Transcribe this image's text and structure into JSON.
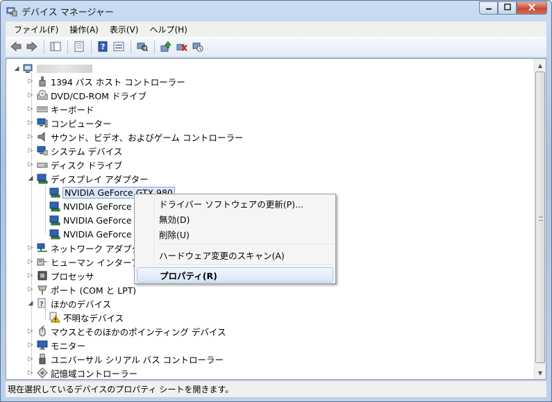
{
  "window": {
    "title": "デバイス マネージャー",
    "minimize_icon": "minimize-icon",
    "maximize_icon": "maximize-icon",
    "close_icon": "close-icon"
  },
  "menubar": {
    "items": [
      "ファイル(F)",
      "操作(A)",
      "表示(V)",
      "ヘルプ(H)"
    ]
  },
  "toolbar": {
    "icons": [
      "back-arrow-icon",
      "forward-arrow-icon",
      "show-hide-tree-icon",
      "properties-icon",
      "help-icon",
      "view-icon",
      "scan-hardware-icon",
      "update-driver-icon",
      "uninstall-icon",
      "disable-device-icon"
    ]
  },
  "tree": {
    "root_label": "",
    "categories": [
      {
        "label": "1394 バス ホスト コントローラー",
        "icon": "bus-controller-icon",
        "expanded": false
      },
      {
        "label": "DVD/CD-ROM ドライブ",
        "icon": "dvd-drive-icon",
        "expanded": false
      },
      {
        "label": "キーボード",
        "icon": "keyboard-icon",
        "expanded": false
      },
      {
        "label": "コンピューター",
        "icon": "computer-icon",
        "expanded": false
      },
      {
        "label": "サウンド、ビデオ、およびゲーム コントローラー",
        "icon": "speaker-icon",
        "expanded": false
      },
      {
        "label": "システム デバイス",
        "icon": "system-device-icon",
        "expanded": false
      },
      {
        "label": "ディスク ドライブ",
        "icon": "disk-drive-icon",
        "expanded": false
      },
      {
        "label": "ディスプレイ アダプター",
        "icon": "display-adapter-icon",
        "expanded": true
      },
      {
        "label": "ネットワーク アダプター",
        "icon": "network-adapter-icon",
        "expanded": false
      },
      {
        "label": "ヒューマン インターフェース デバイス",
        "icon": "hid-icon",
        "expanded": false
      },
      {
        "label": "プロセッサ",
        "icon": "processor-icon",
        "expanded": false
      },
      {
        "label": "ポート (COM と LPT)",
        "icon": "port-icon",
        "expanded": false
      },
      {
        "label": "ほかのデバイス",
        "icon": "other-devices-icon",
        "expanded": true
      },
      {
        "label": "マウスとそのほかのポインティング デバイス",
        "icon": "mouse-icon",
        "expanded": false
      },
      {
        "label": "モニター",
        "icon": "monitor-icon",
        "expanded": false
      },
      {
        "label": "ユニバーサル シリアル バス コントローラー",
        "icon": "usb-icon",
        "expanded": false
      },
      {
        "label": "記憶域コントローラー",
        "icon": "storage-controller-icon",
        "expanded": false
      }
    ],
    "display_adapters": [
      "NVIDIA GeForce GTX 980",
      "NVIDIA GeForce G",
      "NVIDIA GeForce G",
      "NVIDIA GeForce G"
    ],
    "other_devices": [
      "不明なデバイス"
    ]
  },
  "context_menu": {
    "items": [
      "ドライバー ソフトウェアの更新(P)...",
      "無効(D)",
      "削除(U)",
      "ハードウェア変更のスキャン(A)",
      "プロパティ(R)"
    ]
  },
  "statusbar": {
    "text": "現在選択しているデバイスのプロパティ シートを開きます。"
  }
}
